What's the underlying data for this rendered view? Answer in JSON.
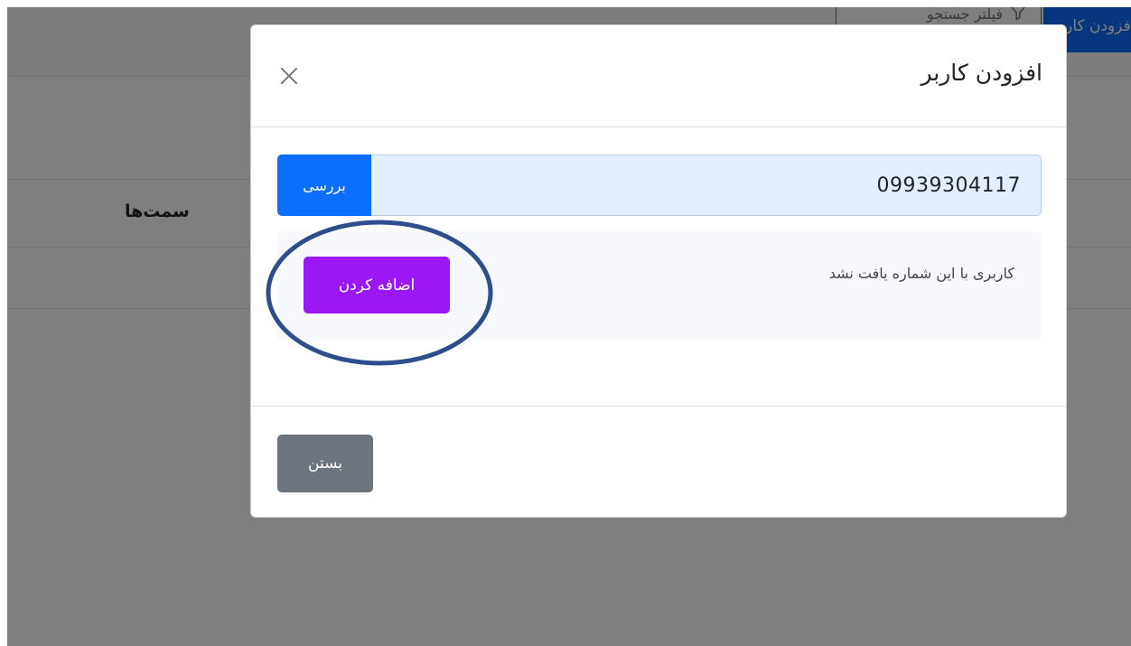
{
  "background": {
    "add_user_button_label": "افزودن کاربر",
    "filter_button_label": "فیلتر جستجو",
    "table_header": "سمت‌ها"
  },
  "modal": {
    "title": "افزودن کاربر",
    "phone_value": "09939304117",
    "check_button_label": "بررسی",
    "result_message": "کاربری با این شماره یافت نشد",
    "add_button_label": "اضافه کردن",
    "close_button_label": "بستن"
  },
  "colors": {
    "primary": "#0d6efd",
    "purple": "#9b18f5",
    "secondary": "#6c757d",
    "annotation": "#2f4d8b"
  },
  "icons": {
    "close": "close-icon",
    "filter": "filter-icon"
  }
}
